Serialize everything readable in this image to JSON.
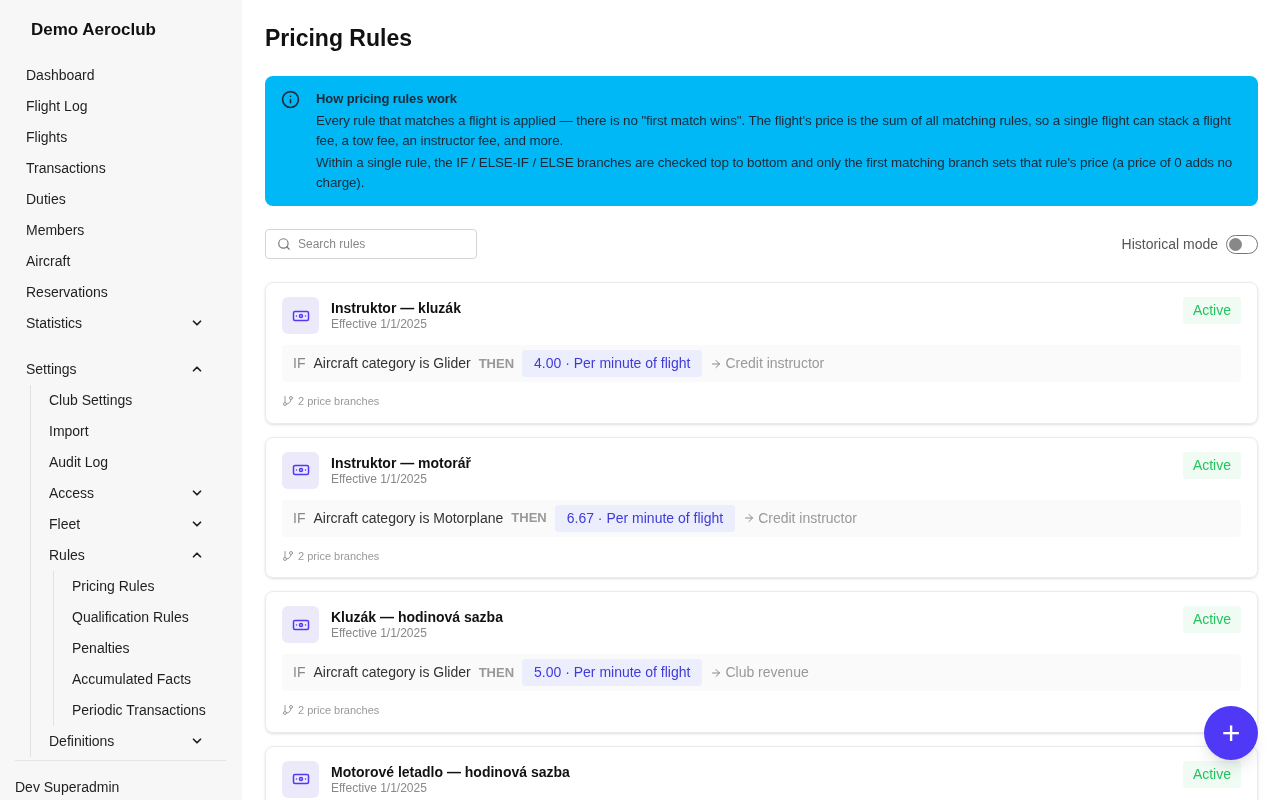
{
  "sidebar": {
    "club_name": "Demo Aeroclub",
    "items": [
      {
        "label": "Dashboard"
      },
      {
        "label": "Flight Log"
      },
      {
        "label": "Flights"
      },
      {
        "label": "Transactions"
      },
      {
        "label": "Duties"
      },
      {
        "label": "Members"
      },
      {
        "label": "Aircraft"
      },
      {
        "label": "Reservations"
      },
      {
        "label": "Statistics",
        "expanded": false
      },
      {
        "label": "Settings",
        "expanded": true,
        "children": [
          {
            "label": "Club Settings"
          },
          {
            "label": "Import"
          },
          {
            "label": "Audit Log"
          },
          {
            "label": "Access",
            "expanded": false
          },
          {
            "label": "Fleet",
            "expanded": false
          },
          {
            "label": "Rules",
            "expanded": true,
            "children": [
              {
                "label": "Pricing Rules"
              },
              {
                "label": "Qualification Rules"
              },
              {
                "label": "Penalties"
              },
              {
                "label": "Accumulated Facts"
              },
              {
                "label": "Periodic Transactions"
              }
            ]
          },
          {
            "label": "Definitions",
            "expanded": false
          }
        ]
      }
    ],
    "user": "Dev Superadmin"
  },
  "page_title": "Pricing Rules",
  "info": {
    "title": "How pricing rules work",
    "paragraphs": [
      "Every rule that matches a flight is applied — there is no \"first match wins\". The flight's price is the sum of all matching rules, so a single flight can stack a flight fee, a tow fee, an instructor fee, and more.",
      "Within a single rule, the IF / ELSE-IF / ELSE branches are checked top to bottom and only the first matching branch sets that rule's price (a price of 0 adds no charge)."
    ]
  },
  "search": {
    "placeholder": "Search rules"
  },
  "historical_mode": {
    "label": "Historical mode",
    "on": false
  },
  "rules": [
    {
      "name": "Instruktor — kluzák",
      "effective": "Effective 1/1/2025",
      "status": "Active",
      "if": "IF",
      "condition": "Aircraft category is Glider",
      "then": "THEN",
      "price": "4.00 · Per minute of flight",
      "target": "Credit instructor",
      "branches": "2 price branches"
    },
    {
      "name": "Instruktor — motorář",
      "effective": "Effective 1/1/2025",
      "status": "Active",
      "if": "IF",
      "condition": "Aircraft category is Motorplane",
      "then": "THEN",
      "price": "6.67 · Per minute of flight",
      "target": "Credit instructor",
      "branches": "2 price branches"
    },
    {
      "name": "Kluzák — hodinová sazba",
      "effective": "Effective 1/1/2025",
      "status": "Active",
      "if": "IF",
      "condition": "Aircraft category is Glider",
      "then": "THEN",
      "price": "5.00 · Per minute of flight",
      "target": "Club revenue",
      "branches": "2 price branches"
    },
    {
      "name": "Motorové letadlo — hodinová sazba",
      "effective": "Effective 1/1/2025",
      "status": "Active"
    }
  ],
  "add_button": {
    "label": "+"
  }
}
